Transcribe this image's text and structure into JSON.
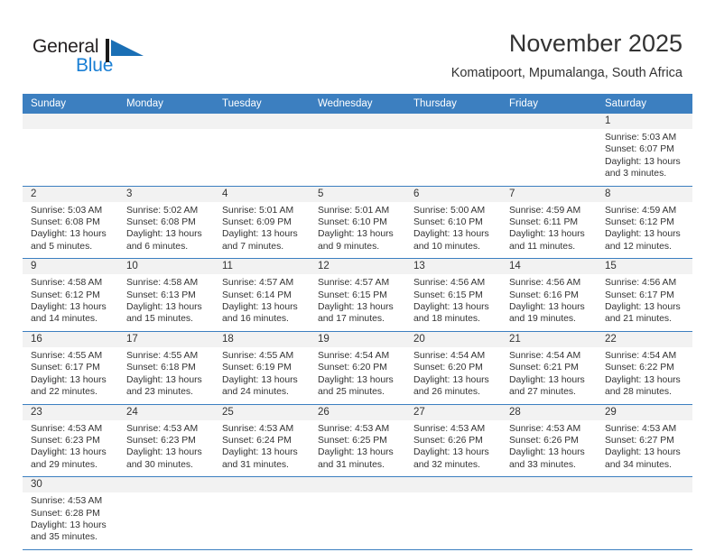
{
  "brand": {
    "name_part1": "General",
    "name_part2": "Blue",
    "accent_color": "#1a7fd4",
    "mark_icon": "triangle-flag-icon"
  },
  "header": {
    "month_title": "November 2025",
    "location": "Komatipoort, Mpumalanga, South Africa",
    "header_bg_color": "#3c7fc0"
  },
  "weekdays": [
    "Sunday",
    "Monday",
    "Tuesday",
    "Wednesday",
    "Thursday",
    "Friday",
    "Saturday"
  ],
  "weeks": [
    [
      {
        "day": "",
        "sunrise": "",
        "sunset": "",
        "daylight_1": "",
        "daylight_2": ""
      },
      {
        "day": "",
        "sunrise": "",
        "sunset": "",
        "daylight_1": "",
        "daylight_2": ""
      },
      {
        "day": "",
        "sunrise": "",
        "sunset": "",
        "daylight_1": "",
        "daylight_2": ""
      },
      {
        "day": "",
        "sunrise": "",
        "sunset": "",
        "daylight_1": "",
        "daylight_2": ""
      },
      {
        "day": "",
        "sunrise": "",
        "sunset": "",
        "daylight_1": "",
        "daylight_2": ""
      },
      {
        "day": "",
        "sunrise": "",
        "sunset": "",
        "daylight_1": "",
        "daylight_2": ""
      },
      {
        "day": "1",
        "sunrise": "Sunrise: 5:03 AM",
        "sunset": "Sunset: 6:07 PM",
        "daylight_1": "Daylight: 13 hours",
        "daylight_2": "and 3 minutes."
      }
    ],
    [
      {
        "day": "2",
        "sunrise": "Sunrise: 5:03 AM",
        "sunset": "Sunset: 6:08 PM",
        "daylight_1": "Daylight: 13 hours",
        "daylight_2": "and 5 minutes."
      },
      {
        "day": "3",
        "sunrise": "Sunrise: 5:02 AM",
        "sunset": "Sunset: 6:08 PM",
        "daylight_1": "Daylight: 13 hours",
        "daylight_2": "and 6 minutes."
      },
      {
        "day": "4",
        "sunrise": "Sunrise: 5:01 AM",
        "sunset": "Sunset: 6:09 PM",
        "daylight_1": "Daylight: 13 hours",
        "daylight_2": "and 7 minutes."
      },
      {
        "day": "5",
        "sunrise": "Sunrise: 5:01 AM",
        "sunset": "Sunset: 6:10 PM",
        "daylight_1": "Daylight: 13 hours",
        "daylight_2": "and 9 minutes."
      },
      {
        "day": "6",
        "sunrise": "Sunrise: 5:00 AM",
        "sunset": "Sunset: 6:10 PM",
        "daylight_1": "Daylight: 13 hours",
        "daylight_2": "and 10 minutes."
      },
      {
        "day": "7",
        "sunrise": "Sunrise: 4:59 AM",
        "sunset": "Sunset: 6:11 PM",
        "daylight_1": "Daylight: 13 hours",
        "daylight_2": "and 11 minutes."
      },
      {
        "day": "8",
        "sunrise": "Sunrise: 4:59 AM",
        "sunset": "Sunset: 6:12 PM",
        "daylight_1": "Daylight: 13 hours",
        "daylight_2": "and 12 minutes."
      }
    ],
    [
      {
        "day": "9",
        "sunrise": "Sunrise: 4:58 AM",
        "sunset": "Sunset: 6:12 PM",
        "daylight_1": "Daylight: 13 hours",
        "daylight_2": "and 14 minutes."
      },
      {
        "day": "10",
        "sunrise": "Sunrise: 4:58 AM",
        "sunset": "Sunset: 6:13 PM",
        "daylight_1": "Daylight: 13 hours",
        "daylight_2": "and 15 minutes."
      },
      {
        "day": "11",
        "sunrise": "Sunrise: 4:57 AM",
        "sunset": "Sunset: 6:14 PM",
        "daylight_1": "Daylight: 13 hours",
        "daylight_2": "and 16 minutes."
      },
      {
        "day": "12",
        "sunrise": "Sunrise: 4:57 AM",
        "sunset": "Sunset: 6:15 PM",
        "daylight_1": "Daylight: 13 hours",
        "daylight_2": "and 17 minutes."
      },
      {
        "day": "13",
        "sunrise": "Sunrise: 4:56 AM",
        "sunset": "Sunset: 6:15 PM",
        "daylight_1": "Daylight: 13 hours",
        "daylight_2": "and 18 minutes."
      },
      {
        "day": "14",
        "sunrise": "Sunrise: 4:56 AM",
        "sunset": "Sunset: 6:16 PM",
        "daylight_1": "Daylight: 13 hours",
        "daylight_2": "and 19 minutes."
      },
      {
        "day": "15",
        "sunrise": "Sunrise: 4:56 AM",
        "sunset": "Sunset: 6:17 PM",
        "daylight_1": "Daylight: 13 hours",
        "daylight_2": "and 21 minutes."
      }
    ],
    [
      {
        "day": "16",
        "sunrise": "Sunrise: 4:55 AM",
        "sunset": "Sunset: 6:17 PM",
        "daylight_1": "Daylight: 13 hours",
        "daylight_2": "and 22 minutes."
      },
      {
        "day": "17",
        "sunrise": "Sunrise: 4:55 AM",
        "sunset": "Sunset: 6:18 PM",
        "daylight_1": "Daylight: 13 hours",
        "daylight_2": "and 23 minutes."
      },
      {
        "day": "18",
        "sunrise": "Sunrise: 4:55 AM",
        "sunset": "Sunset: 6:19 PM",
        "daylight_1": "Daylight: 13 hours",
        "daylight_2": "and 24 minutes."
      },
      {
        "day": "19",
        "sunrise": "Sunrise: 4:54 AM",
        "sunset": "Sunset: 6:20 PM",
        "daylight_1": "Daylight: 13 hours",
        "daylight_2": "and 25 minutes."
      },
      {
        "day": "20",
        "sunrise": "Sunrise: 4:54 AM",
        "sunset": "Sunset: 6:20 PM",
        "daylight_1": "Daylight: 13 hours",
        "daylight_2": "and 26 minutes."
      },
      {
        "day": "21",
        "sunrise": "Sunrise: 4:54 AM",
        "sunset": "Sunset: 6:21 PM",
        "daylight_1": "Daylight: 13 hours",
        "daylight_2": "and 27 minutes."
      },
      {
        "day": "22",
        "sunrise": "Sunrise: 4:54 AM",
        "sunset": "Sunset: 6:22 PM",
        "daylight_1": "Daylight: 13 hours",
        "daylight_2": "and 28 minutes."
      }
    ],
    [
      {
        "day": "23",
        "sunrise": "Sunrise: 4:53 AM",
        "sunset": "Sunset: 6:23 PM",
        "daylight_1": "Daylight: 13 hours",
        "daylight_2": "and 29 minutes."
      },
      {
        "day": "24",
        "sunrise": "Sunrise: 4:53 AM",
        "sunset": "Sunset: 6:23 PM",
        "daylight_1": "Daylight: 13 hours",
        "daylight_2": "and 30 minutes."
      },
      {
        "day": "25",
        "sunrise": "Sunrise: 4:53 AM",
        "sunset": "Sunset: 6:24 PM",
        "daylight_1": "Daylight: 13 hours",
        "daylight_2": "and 31 minutes."
      },
      {
        "day": "26",
        "sunrise": "Sunrise: 4:53 AM",
        "sunset": "Sunset: 6:25 PM",
        "daylight_1": "Daylight: 13 hours",
        "daylight_2": "and 31 minutes."
      },
      {
        "day": "27",
        "sunrise": "Sunrise: 4:53 AM",
        "sunset": "Sunset: 6:26 PM",
        "daylight_1": "Daylight: 13 hours",
        "daylight_2": "and 32 minutes."
      },
      {
        "day": "28",
        "sunrise": "Sunrise: 4:53 AM",
        "sunset": "Sunset: 6:26 PM",
        "daylight_1": "Daylight: 13 hours",
        "daylight_2": "and 33 minutes."
      },
      {
        "day": "29",
        "sunrise": "Sunrise: 4:53 AM",
        "sunset": "Sunset: 6:27 PM",
        "daylight_1": "Daylight: 13 hours",
        "daylight_2": "and 34 minutes."
      }
    ],
    [
      {
        "day": "30",
        "sunrise": "Sunrise: 4:53 AM",
        "sunset": "Sunset: 6:28 PM",
        "daylight_1": "Daylight: 13 hours",
        "daylight_2": "and 35 minutes."
      },
      {
        "day": "",
        "sunrise": "",
        "sunset": "",
        "daylight_1": "",
        "daylight_2": ""
      },
      {
        "day": "",
        "sunrise": "",
        "sunset": "",
        "daylight_1": "",
        "daylight_2": ""
      },
      {
        "day": "",
        "sunrise": "",
        "sunset": "",
        "daylight_1": "",
        "daylight_2": ""
      },
      {
        "day": "",
        "sunrise": "",
        "sunset": "",
        "daylight_1": "",
        "daylight_2": ""
      },
      {
        "day": "",
        "sunrise": "",
        "sunset": "",
        "daylight_1": "",
        "daylight_2": ""
      },
      {
        "day": "",
        "sunrise": "",
        "sunset": "",
        "daylight_1": "",
        "daylight_2": ""
      }
    ]
  ]
}
